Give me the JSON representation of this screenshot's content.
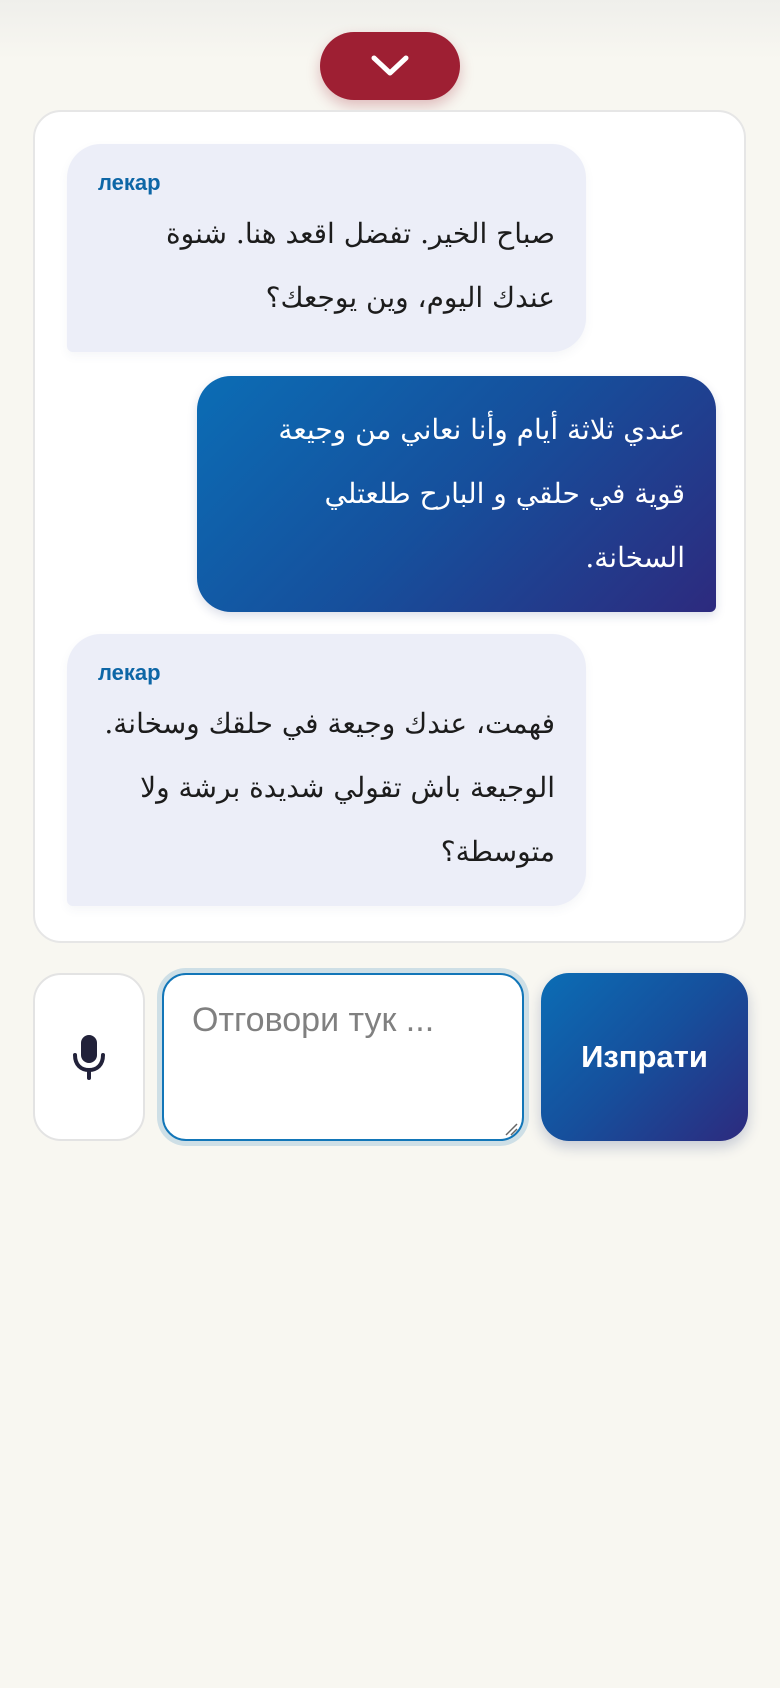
{
  "colors": {
    "accent_red": "#9e1f33",
    "doctor_bubble": "#eceef8",
    "sender_label": "#0d66a6",
    "user_bubble_gradient": [
      "#0b6db5",
      "#2d2a7e"
    ],
    "background": "#f8f7f1"
  },
  "header": {
    "collapse_icon": "chevron-down-icon"
  },
  "messages": [
    {
      "role": "doctor",
      "sender": "лекар",
      "text": "صباح الخير. تفضل اقعد هنا. شنوة عندك اليوم، وين يوجعك؟"
    },
    {
      "role": "user",
      "text": "عندي ثلاثة أيام وأنا نعاني من وجيعة قوية في حلقي و البارح طلعتلي السخانة."
    },
    {
      "role": "doctor",
      "sender": "лекар",
      "text": "فهمت، عندك وجيعة في حلقك وسخانة. الوجيعة باش تقولي شديدة برشة ولا متوسطة؟"
    }
  ],
  "composer": {
    "mic_icon": "microphone-icon",
    "placeholder": "Отговори тук ...",
    "value": "",
    "send_label": "Изпрати"
  }
}
